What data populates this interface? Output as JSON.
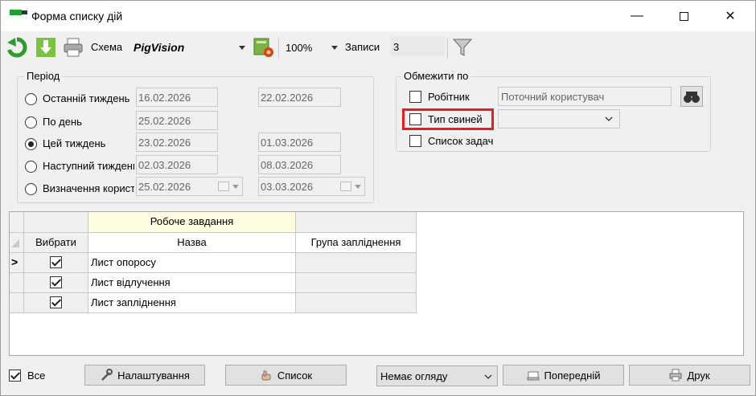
{
  "window": {
    "title": "Форма списку дій"
  },
  "toolbar": {
    "scheme_label": "Схема",
    "scheme_value": "PigVision",
    "zoom_value": "100%",
    "records_label": "Записи",
    "records_value": "3"
  },
  "period": {
    "title": "Період",
    "options": [
      {
        "label": "Останній тиждень",
        "from": "16.02.2026",
        "to": "22.02.2026",
        "selected": false
      },
      {
        "label": "По день",
        "from": "25.02.2026",
        "to": "",
        "selected": false
      },
      {
        "label": "Цей тиждень",
        "from": "23.02.2026",
        "to": "01.03.2026",
        "selected": true
      },
      {
        "label": "Наступний тиждень",
        "from": "02.03.2026",
        "to": "08.03.2026",
        "selected": false
      },
      {
        "label": "Визначення користувачем",
        "from": "25.02.2026",
        "to": "03.03.2026",
        "selected": false
      }
    ]
  },
  "limit": {
    "title": "Обмежити по",
    "worker_label": "Робітник",
    "worker_value": "Поточний користувач",
    "pig_type_label": "Тип свиней",
    "pig_type_value": "",
    "task_list_label": "Список задач"
  },
  "grid": {
    "band_header": "Робоче завдання",
    "columns": [
      "Вибрати",
      "Назва",
      "Група запліднення"
    ],
    "rows": [
      {
        "selected": true,
        "name": "Лист опоросу",
        "group": ""
      },
      {
        "selected": true,
        "name": "Лист відлучення",
        "group": ""
      },
      {
        "selected": true,
        "name": "Лист запліднення",
        "group": ""
      }
    ],
    "current_row_marker": ">"
  },
  "bottom": {
    "all_label": "Все",
    "settings_button": "Налаштування",
    "list_button": "Список",
    "view_select": "Немає огляду",
    "preview_button": "Попередній",
    "print_button": "Друк"
  },
  "colors": {
    "highlight_box": "#e81d24",
    "band_header_bg": "#fdfbe0"
  }
}
